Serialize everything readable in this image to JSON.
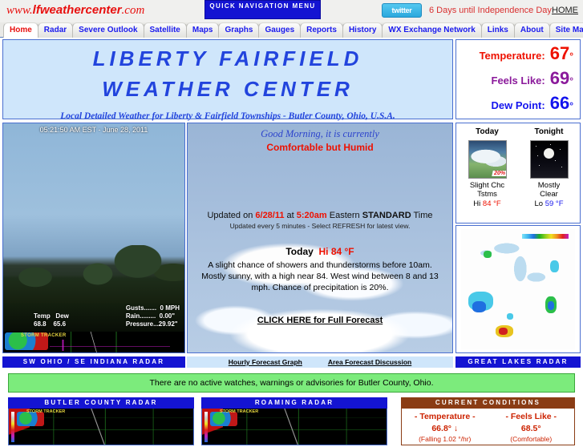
{
  "topbar": {
    "site_url_prefix": "www.",
    "site_url_bold": "lfweathercenter",
    "site_url_suffix": ".com",
    "quicknav_label": "QUICK NAVIGATION MENU",
    "twitter_label": "twitter",
    "countdown": "6 Days until Independence Day",
    "home_label": "HOME"
  },
  "tabs": [
    {
      "label": "Home",
      "active": true
    },
    {
      "label": "Radar",
      "active": false
    },
    {
      "label": "Severe Outlook",
      "active": false
    },
    {
      "label": "Satellite",
      "active": false
    },
    {
      "label": "Maps",
      "active": false
    },
    {
      "label": "Graphs",
      "active": false
    },
    {
      "label": "Gauges",
      "active": false
    },
    {
      "label": "Reports",
      "active": false
    },
    {
      "label": "History",
      "active": false
    },
    {
      "label": "WX Exchange Network",
      "active": false
    },
    {
      "label": "Links",
      "active": false
    },
    {
      "label": "About",
      "active": false
    },
    {
      "label": "Site Map",
      "active": false
    }
  ],
  "banner": {
    "title_line1": "LIBERTY  FAIRFIELD",
    "title_line2": "WEATHER  CENTER",
    "subtitle": "Local Detailed Weather for Liberty & Fairfield Townships - Butler County, Ohio, U.S.A."
  },
  "stats": [
    {
      "label": "Temperature:",
      "value": "67",
      "degree": "°",
      "color": "#ee1100"
    },
    {
      "label": "Feels Like:",
      "value": "69",
      "degree": "°",
      "color": "#8b1a9b"
    },
    {
      "label": "Dew Point:",
      "value": "66",
      "degree": "°",
      "color": "#1414ee"
    }
  ],
  "webcam": {
    "timestamp": "05:21:50 AM EST - June 28, 2011",
    "left_overlay": "Temp   Dew\n68.8    65.6",
    "right_overlay": "Gusts.......  0 MPH\nRain.........  0.00\"\nPressure...29.92\"",
    "logo_text": "STORM TRACKER",
    "strip_label": "SW OHIO / SE INDIANA RADAR"
  },
  "sky": {
    "greeting": "Good Morning, it is currently",
    "condition": "Comfortable but Humid",
    "updated_prefix": "Updated on ",
    "updated_date": "6/28/11",
    "updated_mid": " at ",
    "updated_time": "5:20am",
    "updated_zone_pre": " Eastern ",
    "updated_zone_bold": "STANDARD",
    "updated_zone_post": " Time",
    "updated_sub": "Updated every 5 minutes - Select REFRESH for latest view.",
    "today_label": "Today",
    "today_hi": "Hi 84 °F",
    "forecast_text": "A slight chance of showers and thunderstorms before 10am. Mostly sunny, with a high near 84. West wind between 8 and 13 mph. Chance of precipitation is 20%.",
    "full_forecast_link": "CLICK HERE for Full Forecast",
    "link_hourly": "Hourly Forecast Graph",
    "link_afd": "Area Forecast Discussion"
  },
  "forecast_cells": [
    {
      "day": "Today",
      "icon": "thunderstorm-icon",
      "pct": "20%",
      "desc_line1": "Slight Chc",
      "desc_line2": "Tstms",
      "temp_prefix": "Hi ",
      "temp_value": "84 °F",
      "temp_class": "hi"
    },
    {
      "day": "Tonight",
      "icon": "moon-clear-icon",
      "pct": "",
      "desc_line1": "Mostly",
      "desc_line2": "Clear",
      "temp_prefix": "Lo ",
      "temp_value": "59 °F",
      "temp_class": "lo"
    }
  ],
  "great_lakes": {
    "strip_label": "GREAT LAKES RADAR"
  },
  "alert": {
    "text": "There are no active watches, warnings or advisories for Butler County, Ohio."
  },
  "bottom_panels": [
    {
      "header": "BUTLER COUNTY RADAR"
    },
    {
      "header": "ROAMING RADAR"
    }
  ],
  "current_conditions": {
    "header": "CURRENT CONDITIONS",
    "cells": [
      {
        "title": "- Temperature -",
        "value": "66.8° ↓",
        "note": "(Falling 1.02 °/hr)"
      },
      {
        "title": "- Feels Like -",
        "value": "68.5°",
        "note": "(Comfortable)"
      }
    ]
  },
  "colors": {
    "accent_blue": "#1414d2",
    "banner_blue": "#2244dd",
    "red": "#ee1100",
    "purple": "#8b1a9b",
    "alert_green": "#7ceb7c",
    "cc_brown": "#8a3c14"
  }
}
